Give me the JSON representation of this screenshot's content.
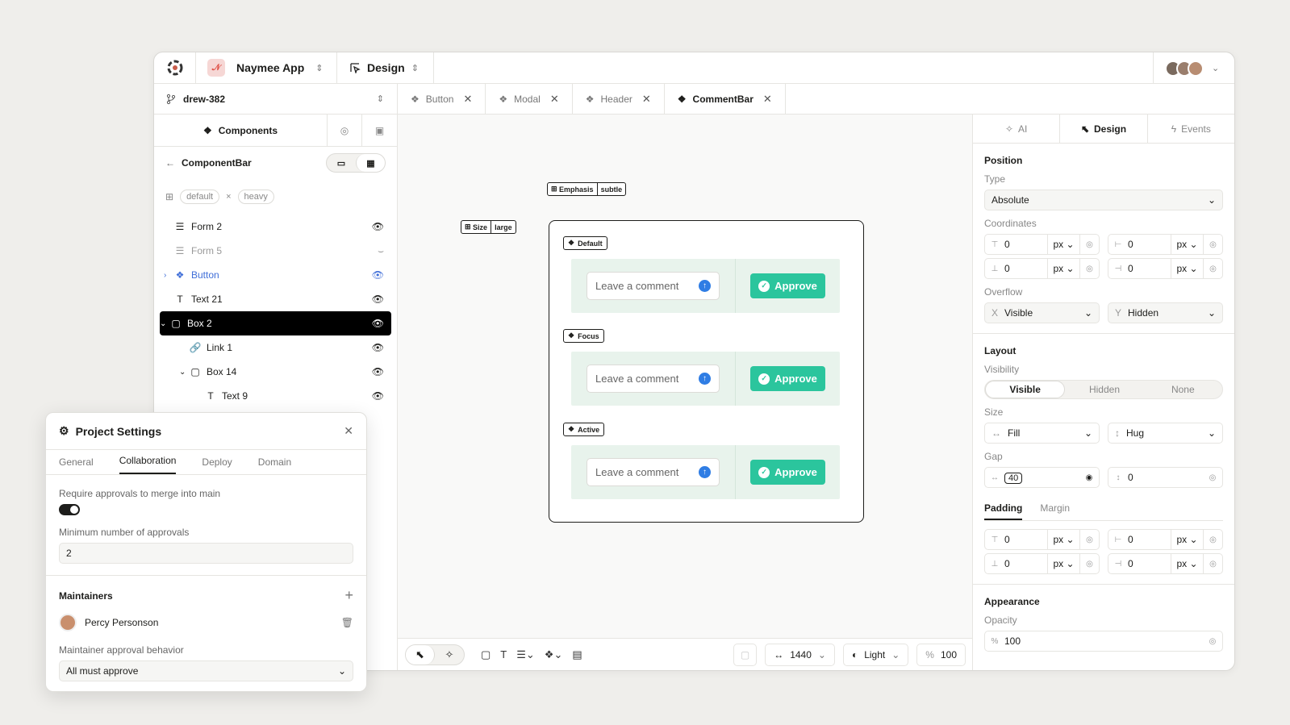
{
  "header": {
    "project": "Naymee App",
    "workspace": "Design"
  },
  "branch": "drew-382",
  "file_tabs": [
    {
      "label": "Button",
      "active": false
    },
    {
      "label": "Modal",
      "active": false
    },
    {
      "label": "Header",
      "active": false
    },
    {
      "label": "CommentBar",
      "active": true
    }
  ],
  "left_panel": {
    "title": "Components",
    "breadcrumb": "ComponentBar",
    "variants": [
      "default",
      "heavy"
    ],
    "variant_sep": "×",
    "layers": [
      {
        "label": "Form 2",
        "icon": "form-icon",
        "indent": 0,
        "state": "normal",
        "visible": true
      },
      {
        "label": "Form 5",
        "icon": "form-icon",
        "indent": 0,
        "state": "dim",
        "visible": false
      },
      {
        "label": "Button",
        "icon": "component-icon",
        "indent": 0,
        "state": "blue",
        "visible": true
      },
      {
        "label": "Text 21",
        "icon": "text-icon",
        "indent": 0,
        "state": "normal",
        "visible": true
      },
      {
        "label": "Box 2",
        "icon": "box-icon",
        "indent": 0,
        "state": "selected",
        "visible": true
      },
      {
        "label": "Link 1",
        "icon": "link-icon",
        "indent": 1,
        "state": "normal",
        "visible": true
      },
      {
        "label": "Box 14",
        "icon": "box-icon",
        "indent": 1,
        "state": "normal",
        "visible": true
      },
      {
        "label": "Text 9",
        "icon": "text-icon",
        "indent": 2,
        "state": "normal",
        "visible": true
      }
    ]
  },
  "canvas": {
    "emphasis_chip": {
      "label": "Emphasis",
      "value": "subtle"
    },
    "size_chip": {
      "label": "Size",
      "value": "large"
    },
    "states": [
      {
        "label": "Default",
        "placeholder": "Leave a comment",
        "button": "Approve"
      },
      {
        "label": "Focus",
        "placeholder": "Leave a comment",
        "button": "Approve"
      },
      {
        "label": "Active",
        "placeholder": "Leave a comment",
        "button": "Approve"
      }
    ]
  },
  "bottom_toolbar": {
    "width": "1440",
    "theme": "Light",
    "zoom_symbol": "%",
    "zoom": "100"
  },
  "right_panel": {
    "tabs": [
      "AI",
      "Design",
      "Events"
    ],
    "position": {
      "title": "Position",
      "type_label": "Type",
      "type": "Absolute",
      "coords_label": "Coordinates",
      "coords": [
        {
          "value": "0",
          "unit": "px"
        },
        {
          "value": "0",
          "unit": "px"
        },
        {
          "value": "0",
          "unit": "px"
        },
        {
          "value": "0",
          "unit": "px"
        }
      ],
      "overflow_label": "Overflow",
      "overflow_x_axis": "X",
      "overflow_x": "Visible",
      "overflow_y_axis": "Y",
      "overflow_y": "Hidden"
    },
    "layout": {
      "title": "Layout",
      "visibility_label": "Visibility",
      "visibility_options": [
        "Visible",
        "Hidden",
        "None"
      ],
      "size_label": "Size",
      "width": "Fill",
      "height": "Hug",
      "gap_label": "Gap",
      "gap_x": "40",
      "gap_y": "0",
      "spacing_tabs": [
        "Padding",
        "Margin"
      ],
      "padding": [
        {
          "value": "0",
          "unit": "px"
        },
        {
          "value": "0",
          "unit": "px"
        },
        {
          "value": "0",
          "unit": "px"
        },
        {
          "value": "0",
          "unit": "px"
        }
      ]
    },
    "appearance": {
      "title": "Appearance",
      "opacity_label": "Opacity",
      "opacity_symbol": "%",
      "opacity": "100"
    }
  },
  "project_settings": {
    "title": "Project Settings",
    "tabs": [
      "General",
      "Collaboration",
      "Deploy",
      "Domain"
    ],
    "require_label": "Require approvals to merge into main",
    "require_on": true,
    "min_label": "Minimum number of approvals",
    "min_value": "2",
    "maintainers_label": "Maintainers",
    "maintainer": "Percy Personson",
    "behavior_label": "Maintainer approval behavior",
    "behavior": "All must approve"
  },
  "colors": {
    "accent_green": "#2bc59d",
    "accent_blue": "#2f7de4",
    "selected_row": "#000000",
    "layer_blue": "#3f6ed8"
  }
}
